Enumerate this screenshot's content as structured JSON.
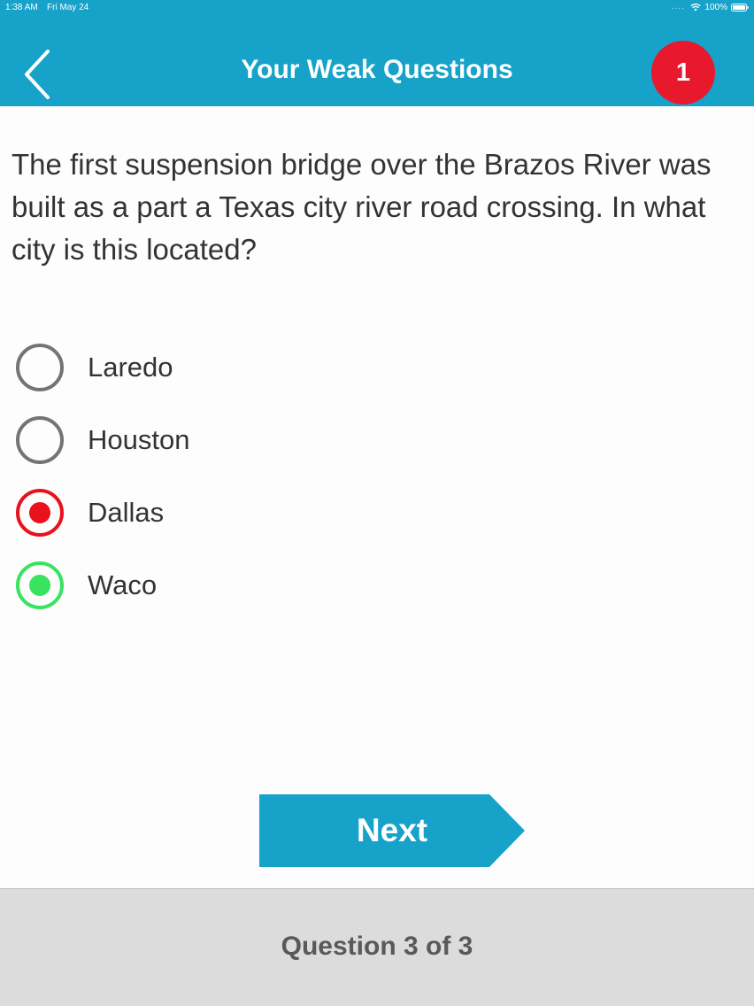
{
  "status_bar": {
    "time": "1:38 AM",
    "date": "Fri May 24",
    "signal_dots": "....",
    "battery_percent": "100%"
  },
  "header": {
    "title": "Your Weak Questions",
    "badge_count": "1",
    "accent_color": "#16a2c9",
    "badge_color": "#e8192c"
  },
  "question": {
    "text": "The first suspension bridge over the Brazos River was built as a part a Texas city river road crossing. In what city is this located?"
  },
  "answers": [
    {
      "label": "Laredo",
      "state": "unselected"
    },
    {
      "label": "Houston",
      "state": "unselected"
    },
    {
      "label": "Dallas",
      "state": "wrong",
      "color": "#e8111c"
    },
    {
      "label": "Waco",
      "state": "correct",
      "color": "#37e35f"
    }
  ],
  "actions": {
    "next_label": "Next"
  },
  "footer": {
    "progress_text": "Question 3 of 3"
  }
}
